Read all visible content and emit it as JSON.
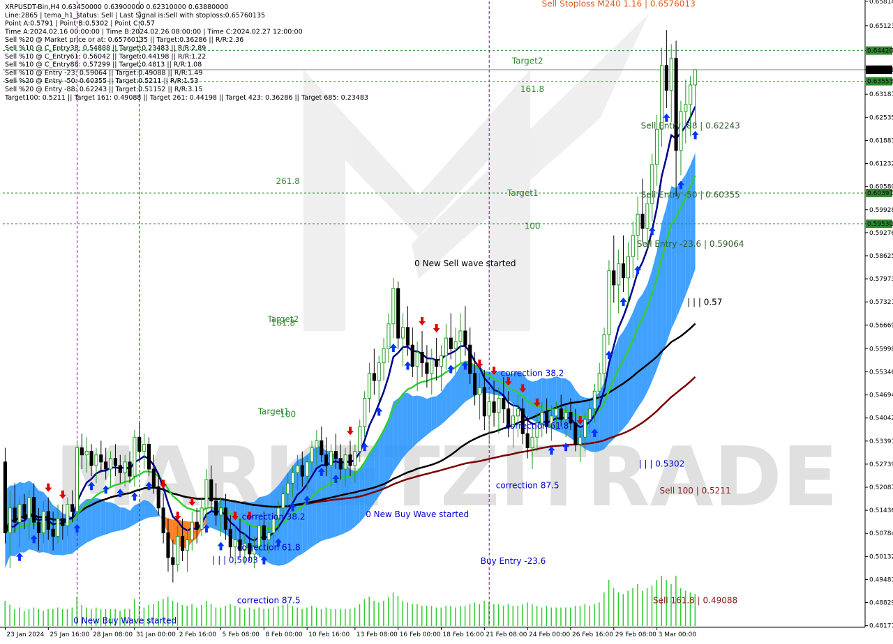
{
  "colors": {
    "background": "#ffffff",
    "grid": "#000000",
    "bull": "#1f9a1f",
    "bear": "#000000",
    "wave_marker": "#8b008b",
    "sma_red": "#7b0000",
    "sma_black": "#000000",
    "ema_navy": "#00008b",
    "ema_green": "#32cd32",
    "cloud_orange": "#ff6a00",
    "cloud_blue": "#1e90ff",
    "cloud_brown": "#cd853f",
    "arrow_up": "#0033ff",
    "arrow_down": "#e00000",
    "target_line": "#2e8b2e",
    "current_line": "#708090",
    "volume": "#32cd32",
    "watermark": "#c8c8c8"
  },
  "info_lines": [
    "XRPUSDT-Bin,H4  0.63450000 0.63900000 0.62310000 0.63880000",
    "Line:2865  | tema_h1_status: Sell  | Last Signal is:Sell with stoploss:0.65760135",
    "Point A:0.5791  | Point B:0.5302  | Point C:0.57",
    "Time A:2024.02.16 00:00:00  | Time B:2024.02.26 08:00:00  | Time C:2024.02.27 12:00:00",
    "Sell %20 @ Market price or at: 0.65760135  || Target:0.36286  || R/R:2.36",
    "Sell %10 @ C_Entry38: 0.54888  || Target:0.23483  || R/R:2.89",
    "Sell %10 @ C_Entry61: 0.56042  || Target:0.44198  || R/R:1.22",
    "Sell %10 @ C_Entry88: 0.57299  || Target:0.4813  || R/R:1.08",
    "Sell %10 @ Entry -23: 0.59064  || Target:0.49088  || R/R:1.49",
    "Sell %20 @ Entry -50: 0.60355  || Target:0.5211  || R/R:1.53",
    "Sell %20 @ Entry -88: 0.62243  || Target:0.51152  || R/R:3.15",
    "Target100: 0.5211  || Target 161: 0.49088  || Target 261: 0.44198  || Target 423: 0.36286  || Target 685: 0.23483"
  ],
  "watermark": "MARKETZITRADE",
  "chart_data": {
    "type": "candlestick",
    "symbol": "XRPUSDT-Bin",
    "timeframe": "H4",
    "ohlc_last": {
      "open": 0.6345,
      "high": 0.639,
      "low": 0.6231,
      "close": 0.6388
    },
    "ylim": [
      0.4817,
      0.6581
    ],
    "y_ticks": [
      0.65814,
      0.65123,
      0.6442,
      0.6388,
      0.63553,
      0.63187,
      0.62535,
      0.61883,
      0.61232,
      0.6058,
      0.60397,
      0.59928,
      0.5953,
      0.59276,
      0.58625,
      0.57973,
      0.57321,
      0.56669,
      0.55998,
      0.55346,
      0.54694,
      0.54042,
      0.53391,
      0.52739,
      0.52087,
      0.51436,
      0.50784,
      0.50132,
      0.49481,
      0.48829,
      0.48177
    ],
    "y_highlight_labels": [
      {
        "label": "0.64420",
        "color": "#2e8b2e"
      },
      {
        "label": "0.63880",
        "color": "#000000"
      },
      {
        "label": "0.63553",
        "color": "#2e8b2e"
      },
      {
        "label": "0.60397",
        "color": "#2e8b2e"
      },
      {
        "label": "0.59530",
        "color": "#2e8b2e"
      }
    ],
    "x_labels": [
      "23 Jan 2024",
      "25 Jan 16:00",
      "28 Jan 08:00",
      "31 Jan 00:00",
      "2 Feb 16:00",
      "5 Feb 08:00",
      "8 Feb 00:00",
      "10 Feb 16:00",
      "13 Feb 08:00",
      "16 Feb 00:00",
      "18 Feb 16:00",
      "21 Feb 08:00",
      "24 Feb 00:00",
      "26 Feb 16:00",
      "29 Feb 08:00",
      "3 Mar 00:00"
    ],
    "horizontal_lines": [
      {
        "value": 0.6442,
        "style": "dashed",
        "color": "#2e8b2e"
      },
      {
        "value": 0.6388,
        "style": "solid",
        "color": "#708090"
      },
      {
        "value": 0.63553,
        "style": "dashed",
        "color": "#2e8b2e"
      },
      {
        "value": 0.60397,
        "style": "dashed",
        "color": "#2e8b2e"
      },
      {
        "value": 0.5953,
        "style": "dashed",
        "color": "#2e8b2e"
      }
    ],
    "annotations": [
      {
        "text": "Sell Stoploss M240 1.16 | 0.6576013",
        "color": "#e05a1a",
        "x_index": 128,
        "value": 0.6566
      },
      {
        "text": "Target2",
        "color": "#2e8b2e",
        "x_index": 109,
        "value": 0.6405
      },
      {
        "text": "161.8",
        "color": "#2e8b2e",
        "x_index": 110,
        "value": 0.6325
      },
      {
        "text": "Sell Entry -88 | 0.62243",
        "color": "#2e5e2e",
        "x_index": 143,
        "value": 0.6222
      },
      {
        "text": "261.8",
        "color": "#2e8b2e",
        "x_index": 59,
        "value": 0.6065
      },
      {
        "text": "Target1",
        "color": "#2e8b2e",
        "x_index": 108,
        "value": 0.6032
      },
      {
        "text": "Sell Entry -50 | 0.60355",
        "color": "#2e5e2e",
        "x_index": 143,
        "value": 0.6027
      },
      {
        "text": "100",
        "color": "#2e8b2e",
        "x_index": 110,
        "value": 0.5938
      },
      {
        "text": "Sell Entry -23.6 | 0.59064",
        "color": "#2e5e2e",
        "x_index": 143,
        "value": 0.5888
      },
      {
        "text": "0 New Sell wave started",
        "color": "#000000",
        "x_index": 96,
        "value": 0.5833
      },
      {
        "text": "| | | 0.57",
        "color": "#000000",
        "x_index": 146,
        "value": 0.5724
      },
      {
        "text": "Target2",
        "color": "#2e8b2e",
        "x_index": 58,
        "value": 0.5675
      },
      {
        "text": "161.8",
        "color": "#2e8b2e",
        "x_index": 58,
        "value": 0.5665
      },
      {
        "text": "correction 38.2",
        "color": "#0000cd",
        "x_index": 110,
        "value": 0.5523
      },
      {
        "text": "Target1",
        "color": "#2e8b2e",
        "x_index": 56,
        "value": 0.5415
      },
      {
        "text": "100",
        "color": "#2e8b2e",
        "x_index": 59,
        "value": 0.5407
      },
      {
        "text": "correction 61.8",
        "color": "#0000cd",
        "x_index": 111,
        "value": 0.5374
      },
      {
        "text": "| | | 0.5302",
        "color": "#0000cd",
        "x_index": 137,
        "value": 0.5267
      },
      {
        "text": "correction 87.5",
        "color": "#0000cd",
        "x_index": 109,
        "value": 0.5206
      },
      {
        "text": "Sell 100 | 0.5211",
        "color": "#8b1a1a",
        "x_index": 144,
        "value": 0.5191
      },
      {
        "text": "0 New Buy Wave started",
        "color": "#0000cd",
        "x_index": 86,
        "value": 0.5124
      },
      {
        "text": "correction 38.2",
        "color": "#0000cd",
        "x_index": 56,
        "value": 0.5117
      },
      {
        "text": "correction 61.8",
        "color": "#0000cd",
        "x_index": 55,
        "value": 0.5031
      },
      {
        "text": "| | | 0.5003",
        "color": "#0000cd",
        "x_index": 48,
        "value": 0.4995
      },
      {
        "text": "Buy Entry -23.6",
        "color": "#0000cd",
        "x_index": 106,
        "value": 0.4992
      },
      {
        "text": "correction 87.5",
        "color": "#0000cd",
        "x_index": 55,
        "value": 0.4881
      },
      {
        "text": "Sell 161.8 | 0.49088",
        "color": "#8b1a1a",
        "x_index": 144,
        "value": 0.4881
      },
      {
        "text": "0 New Buy Wave started",
        "color": "#0000cd",
        "x_index": 25,
        "value": 0.4824
      }
    ],
    "wave_markers_x_index": [
      15,
      28,
      101
    ],
    "ohlc": [
      [
        0.528,
        0.532,
        0.505,
        0.508
      ],
      [
        0.508,
        0.52,
        0.498,
        0.515
      ],
      [
        0.515,
        0.522,
        0.508,
        0.511
      ],
      [
        0.511,
        0.518,
        0.504,
        0.516
      ],
      [
        0.516,
        0.519,
        0.509,
        0.512
      ],
      [
        0.512,
        0.52,
        0.506,
        0.518
      ],
      [
        0.518,
        0.522,
        0.509,
        0.511
      ],
      [
        0.511,
        0.515,
        0.503,
        0.508
      ],
      [
        0.508,
        0.517,
        0.505,
        0.514
      ],
      [
        0.514,
        0.518,
        0.506,
        0.509
      ],
      [
        0.509,
        0.514,
        0.503,
        0.507
      ],
      [
        0.507,
        0.516,
        0.505,
        0.512
      ],
      [
        0.512,
        0.516,
        0.506,
        0.51
      ],
      [
        0.51,
        0.518,
        0.507,
        0.516
      ],
      [
        0.516,
        0.52,
        0.511,
        0.514
      ],
      [
        0.514,
        0.534,
        0.512,
        0.532
      ],
      [
        0.532,
        0.536,
        0.526,
        0.53
      ],
      [
        0.53,
        0.535,
        0.525,
        0.531
      ],
      [
        0.531,
        0.533,
        0.524,
        0.527
      ],
      [
        0.527,
        0.532,
        0.522,
        0.53
      ],
      [
        0.53,
        0.534,
        0.525,
        0.528
      ],
      [
        0.528,
        0.532,
        0.523,
        0.526
      ],
      [
        0.526,
        0.531,
        0.521,
        0.529
      ],
      [
        0.529,
        0.533,
        0.524,
        0.527
      ],
      [
        0.527,
        0.53,
        0.522,
        0.525
      ],
      [
        0.525,
        0.53,
        0.521,
        0.528
      ],
      [
        0.528,
        0.531,
        0.522,
        0.524
      ],
      [
        0.524,
        0.537,
        0.521,
        0.535
      ],
      [
        0.535,
        0.539,
        0.529,
        0.531
      ],
      [
        0.531,
        0.536,
        0.526,
        0.533
      ],
      [
        0.533,
        0.535,
        0.524,
        0.526
      ],
      [
        0.526,
        0.53,
        0.519,
        0.521
      ],
      [
        0.521,
        0.525,
        0.513,
        0.515
      ],
      [
        0.515,
        0.519,
        0.505,
        0.508
      ],
      [
        0.508,
        0.512,
        0.497,
        0.501
      ],
      [
        0.501,
        0.506,
        0.494,
        0.499
      ],
      [
        0.499,
        0.51,
        0.497,
        0.507
      ],
      [
        0.507,
        0.512,
        0.5,
        0.503
      ],
      [
        0.503,
        0.509,
        0.497,
        0.506
      ],
      [
        0.506,
        0.514,
        0.503,
        0.511
      ],
      [
        0.511,
        0.515,
        0.505,
        0.509
      ],
      [
        0.509,
        0.518,
        0.507,
        0.515
      ],
      [
        0.515,
        0.526,
        0.512,
        0.523
      ],
      [
        0.523,
        0.527,
        0.514,
        0.517
      ],
      [
        0.517,
        0.522,
        0.51,
        0.513
      ],
      [
        0.513,
        0.518,
        0.507,
        0.515
      ],
      [
        0.515,
        0.519,
        0.506,
        0.509
      ],
      [
        0.509,
        0.513,
        0.501,
        0.504
      ],
      [
        0.504,
        0.51,
        0.499,
        0.506
      ],
      [
        0.506,
        0.512,
        0.501,
        0.503
      ],
      [
        0.503,
        0.508,
        0.499,
        0.505
      ],
      [
        0.505,
        0.51,
        0.5,
        0.502
      ],
      [
        0.502,
        0.507,
        0.498,
        0.504
      ],
      [
        0.504,
        0.512,
        0.501,
        0.51
      ],
      [
        0.51,
        0.514,
        0.503,
        0.506
      ],
      [
        0.506,
        0.511,
        0.502,
        0.508
      ],
      [
        0.508,
        0.514,
        0.504,
        0.512
      ],
      [
        0.512,
        0.517,
        0.508,
        0.515
      ],
      [
        0.515,
        0.521,
        0.512,
        0.519
      ],
      [
        0.519,
        0.525,
        0.515,
        0.522
      ],
      [
        0.522,
        0.527,
        0.518,
        0.525
      ],
      [
        0.525,
        0.53,
        0.52,
        0.527
      ],
      [
        0.527,
        0.531,
        0.521,
        0.524
      ],
      [
        0.524,
        0.53,
        0.52,
        0.528
      ],
      [
        0.528,
        0.534,
        0.525,
        0.532
      ],
      [
        0.532,
        0.537,
        0.527,
        0.534
      ],
      [
        0.534,
        0.538,
        0.528,
        0.53
      ],
      [
        0.53,
        0.535,
        0.524,
        0.527
      ],
      [
        0.527,
        0.533,
        0.521,
        0.531
      ],
      [
        0.531,
        0.536,
        0.526,
        0.529
      ],
      [
        0.529,
        0.533,
        0.523,
        0.526
      ],
      [
        0.526,
        0.532,
        0.521,
        0.53
      ],
      [
        0.53,
        0.534,
        0.524,
        0.527
      ],
      [
        0.527,
        0.533,
        0.522,
        0.531
      ],
      [
        0.531,
        0.54,
        0.528,
        0.538
      ],
      [
        0.538,
        0.548,
        0.535,
        0.546
      ],
      [
        0.546,
        0.556,
        0.542,
        0.553
      ],
      [
        0.553,
        0.56,
        0.547,
        0.551
      ],
      [
        0.551,
        0.558,
        0.545,
        0.556
      ],
      [
        0.556,
        0.563,
        0.551,
        0.56
      ],
      [
        0.56,
        0.57,
        0.556,
        0.567
      ],
      [
        0.567,
        0.58,
        0.563,
        0.577
      ],
      [
        0.577,
        0.579,
        0.56,
        0.563
      ],
      [
        0.563,
        0.57,
        0.555,
        0.566
      ],
      [
        0.566,
        0.572,
        0.558,
        0.561
      ],
      [
        0.561,
        0.566,
        0.552,
        0.555
      ],
      [
        0.555,
        0.562,
        0.548,
        0.559
      ],
      [
        0.559,
        0.565,
        0.552,
        0.556
      ],
      [
        0.556,
        0.561,
        0.549,
        0.553
      ],
      [
        0.553,
        0.56,
        0.547,
        0.557
      ],
      [
        0.557,
        0.563,
        0.551,
        0.555
      ],
      [
        0.555,
        0.561,
        0.548,
        0.558
      ],
      [
        0.558,
        0.567,
        0.554,
        0.563
      ],
      [
        0.563,
        0.57,
        0.557,
        0.56
      ],
      [
        0.56,
        0.566,
        0.553,
        0.562
      ],
      [
        0.562,
        0.57,
        0.556,
        0.565
      ],
      [
        0.565,
        0.572,
        0.558,
        0.561
      ],
      [
        0.561,
        0.566,
        0.55,
        0.553
      ],
      [
        0.553,
        0.559,
        0.544,
        0.547
      ],
      [
        0.547,
        0.553,
        0.54,
        0.549
      ],
      [
        0.549,
        0.554,
        0.537,
        0.541
      ],
      [
        0.541,
        0.548,
        0.533,
        0.545
      ],
      [
        0.545,
        0.551,
        0.538,
        0.542
      ],
      [
        0.542,
        0.549,
        0.536,
        0.546
      ],
      [
        0.546,
        0.552,
        0.539,
        0.543
      ],
      [
        0.543,
        0.548,
        0.535,
        0.538
      ],
      [
        0.538,
        0.545,
        0.532,
        0.541
      ],
      [
        0.541,
        0.547,
        0.535,
        0.543
      ],
      [
        0.543,
        0.546,
        0.533,
        0.536
      ],
      [
        0.536,
        0.541,
        0.529,
        0.532
      ],
      [
        0.532,
        0.538,
        0.526,
        0.535
      ],
      [
        0.535,
        0.542,
        0.531,
        0.539
      ],
      [
        0.539,
        0.545,
        0.535,
        0.542
      ],
      [
        0.542,
        0.546,
        0.536,
        0.538
      ],
      [
        0.538,
        0.544,
        0.534,
        0.541
      ],
      [
        0.541,
        0.545,
        0.537,
        0.543
      ],
      [
        0.543,
        0.547,
        0.538,
        0.54
      ],
      [
        0.54,
        0.544,
        0.535,
        0.542
      ],
      [
        0.542,
        0.546,
        0.537,
        0.539
      ],
      [
        0.539,
        0.543,
        0.531,
        0.533
      ],
      [
        0.533,
        0.537,
        0.528,
        0.535
      ],
      [
        0.535,
        0.542,
        0.531,
        0.54
      ],
      [
        0.54,
        0.545,
        0.536,
        0.543
      ],
      [
        0.543,
        0.55,
        0.539,
        0.548
      ],
      [
        0.548,
        0.556,
        0.544,
        0.553
      ],
      [
        0.553,
        0.566,
        0.549,
        0.564
      ],
      [
        0.564,
        0.585,
        0.561,
        0.582
      ],
      [
        0.582,
        0.592,
        0.573,
        0.578
      ],
      [
        0.578,
        0.588,
        0.57,
        0.584
      ],
      [
        0.584,
        0.592,
        0.576,
        0.58
      ],
      [
        0.58,
        0.59,
        0.572,
        0.586
      ],
      [
        0.586,
        0.596,
        0.58,
        0.592
      ],
      [
        0.592,
        0.603,
        0.585,
        0.598
      ],
      [
        0.598,
        0.608,
        0.59,
        0.594
      ],
      [
        0.594,
        0.604,
        0.588,
        0.601
      ],
      [
        0.601,
        0.615,
        0.596,
        0.612
      ],
      [
        0.612,
        0.626,
        0.606,
        0.622
      ],
      [
        0.622,
        0.645,
        0.617,
        0.64
      ],
      [
        0.64,
        0.65,
        0.628,
        0.633
      ],
      [
        0.633,
        0.646,
        0.624,
        0.642
      ],
      [
        0.642,
        0.647,
        0.603,
        0.616
      ],
      [
        0.616,
        0.63,
        0.609,
        0.627
      ],
      [
        0.627,
        0.636,
        0.618,
        0.629
      ],
      [
        0.629,
        0.637,
        0.62,
        0.6345
      ],
      [
        0.6345,
        0.639,
        0.6231,
        0.6388
      ]
    ],
    "volume": [
      0.3,
      0.25,
      0.2,
      0.22,
      0.18,
      0.2,
      0.22,
      0.2,
      0.18,
      0.2,
      0.2,
      0.22,
      0.2,
      0.2,
      0.22,
      0.35,
      0.25,
      0.22,
      0.2,
      0.22,
      0.2,
      0.2,
      0.2,
      0.2,
      0.18,
      0.2,
      0.2,
      0.32,
      0.24,
      0.22,
      0.25,
      0.26,
      0.3,
      0.32,
      0.35,
      0.3,
      0.28,
      0.25,
      0.24,
      0.26,
      0.22,
      0.25,
      0.3,
      0.26,
      0.22,
      0.22,
      0.24,
      0.26,
      0.24,
      0.22,
      0.2,
      0.22,
      0.2,
      0.22,
      0.2,
      0.2,
      0.22,
      0.24,
      0.25,
      0.26,
      0.24,
      0.22,
      0.2,
      0.22,
      0.24,
      0.22,
      0.2,
      0.22,
      0.2,
      0.2,
      0.2,
      0.2,
      0.2,
      0.22,
      0.26,
      0.32,
      0.35,
      0.3,
      0.28,
      0.3,
      0.34,
      0.4,
      0.36,
      0.3,
      0.28,
      0.26,
      0.26,
      0.24,
      0.24,
      0.24,
      0.22,
      0.22,
      0.24,
      0.24,
      0.22,
      0.24,
      0.24,
      0.26,
      0.28,
      0.26,
      0.3,
      0.28,
      0.26,
      0.26,
      0.24,
      0.26,
      0.24,
      0.24,
      0.26,
      0.28,
      0.26,
      0.24,
      0.22,
      0.24,
      0.22,
      0.22,
      0.22,
      0.22,
      0.22,
      0.24,
      0.24,
      0.26,
      0.24,
      0.26,
      0.28,
      0.4,
      0.55,
      0.45,
      0.4,
      0.38,
      0.42,
      0.45,
      0.5,
      0.42,
      0.45,
      0.48,
      0.55,
      0.6,
      0.55,
      0.5,
      0.6,
      0.45,
      0.42,
      0.4,
      0.38
    ]
  }
}
